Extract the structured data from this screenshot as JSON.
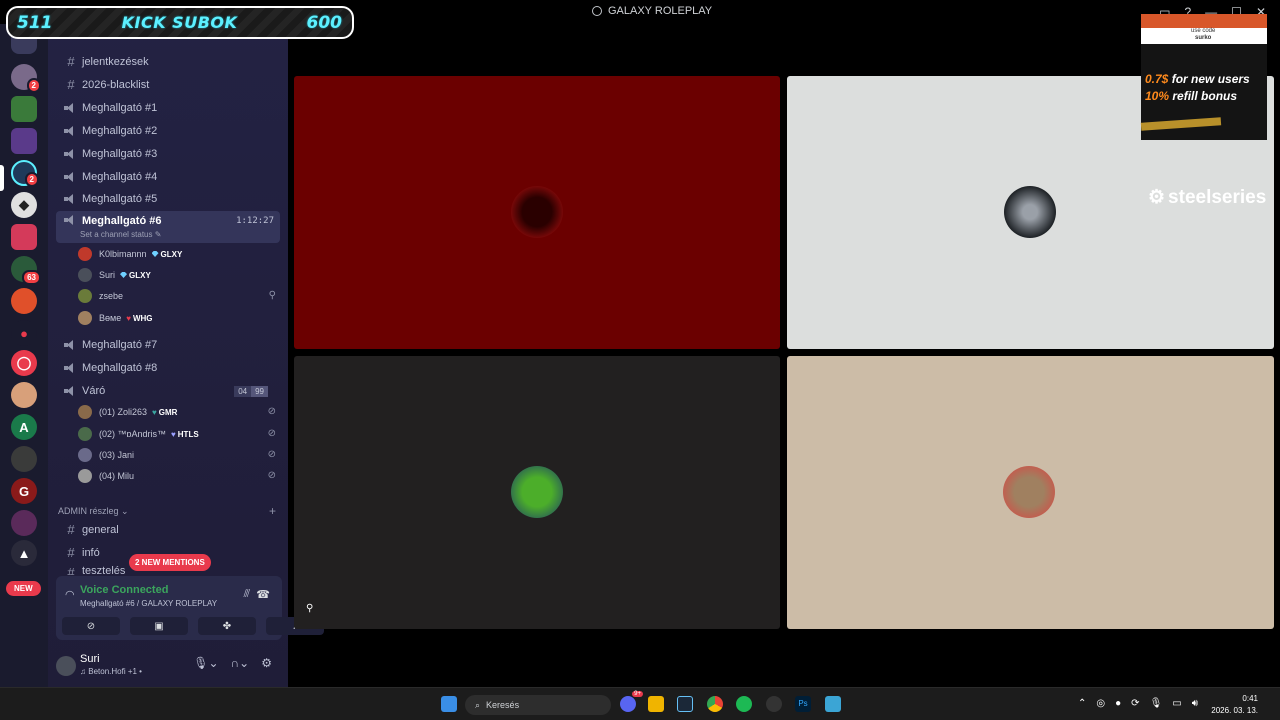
{
  "window": {
    "title": "GALAXY ROLEPLAY"
  },
  "kick_banner": {
    "left": "511",
    "middle": "KICK SUBOK",
    "right": "600"
  },
  "rail": {
    "badges": [
      "2",
      "2",
      "63"
    ],
    "new_label": "NEW"
  },
  "sidebar": {
    "guild_name": "GALAXY ROLEPLAY",
    "channels": [
      {
        "type": "text",
        "label": "jelentkezések"
      },
      {
        "type": "text",
        "label": "2026-blacklist"
      },
      {
        "type": "voice",
        "label": "Meghallgató #1"
      },
      {
        "type": "voice",
        "label": "Meghallgató #2"
      },
      {
        "type": "voice",
        "label": "Meghallgató #3"
      },
      {
        "type": "voice",
        "label": "Meghallgató #4"
      },
      {
        "type": "voice",
        "label": "Meghallgató #5"
      }
    ],
    "active_channel": {
      "label": "Meghallgató #6",
      "timer": "1:12:27",
      "status": "Set a channel status"
    },
    "active_members": [
      {
        "name": "K0lbimannn",
        "tag": "GLXY",
        "color": "#c0392b"
      },
      {
        "name": "Suri",
        "tag": "GLXY",
        "color": "#4a4f5a"
      },
      {
        "name": "zsebe",
        "tag": "",
        "color": "#6a7b3a"
      },
      {
        "name": "Вөме",
        "tag": "WHG",
        "color": "#a08060"
      }
    ],
    "more_channels": [
      {
        "type": "voice",
        "label": "Meghallgató #7"
      },
      {
        "type": "voice",
        "label": "Meghallgató #8"
      }
    ],
    "waiting_room": {
      "label": "Váró",
      "count_a": "04",
      "count_b": "99"
    },
    "waiting_members": [
      {
        "name": "(01) Zoli263",
        "tag": "GMR",
        "color": "#8a6a4a"
      },
      {
        "name": "(02) ™ɒAndris™",
        "tag": "HTLS",
        "color": "#4a6a4a"
      },
      {
        "name": "(03) Jani",
        "tag": "",
        "color": "#6a6a8a"
      },
      {
        "name": "(04) Milu",
        "tag": "",
        "color": "#9a9a9a"
      }
    ],
    "admin_category": "ADMIN részleg",
    "admin_channels": [
      {
        "label": "general"
      },
      {
        "label": "infó"
      },
      {
        "label": "tesztelés"
      }
    ],
    "mentions_label": "2 NEW MENTIONS"
  },
  "voice_panel": {
    "title": "Voice Connected",
    "subtitle": "Meghallgató #6 / GALAXY ROLEPLAY"
  },
  "user_panel": {
    "name": "Suri",
    "status": "Beton.Hofi +1 •"
  },
  "ad_overlay": {
    "code_label": "use code",
    "code": "surko",
    "line1_value": "0.7$",
    "line1_text": "for new users",
    "line2_value": "10%",
    "line2_text": "refill bonus"
  },
  "watermark": "steelseries",
  "taskbar": {
    "search_placeholder": "Keresés",
    "time": "0:41",
    "date": "2026. 03. 13.",
    "discord_badge": "9+"
  },
  "colors": {
    "tile_red": "#6b0000",
    "tile_light": "#dcdedd",
    "tile_dark": "#222020",
    "tile_beige": "#ccbca7",
    "accent_green": "#3ba55d",
    "kick_cyan": "#5cf0ff"
  }
}
